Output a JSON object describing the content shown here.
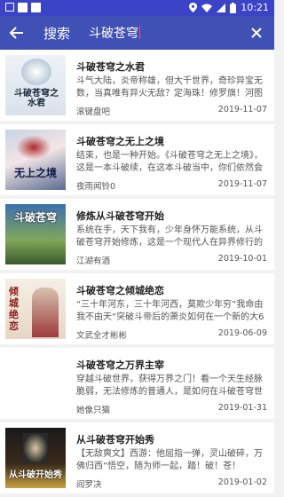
{
  "status_bar": {
    "time": "10:21"
  },
  "app_bar": {
    "title": "搜索",
    "query": "斗破苍穹"
  },
  "results": [
    {
      "title": "斗破苍穹之水君",
      "desc": "斗气大陆，炎帝称雄，但大千世界，奇珍异宝无数，当真唯有异火无敌？定海珠！修罗旗！河图洛",
      "author": "滚键盘吧",
      "date": "2019-11-07",
      "cover_text": "斗破苍穹之水君"
    },
    {
      "title": "斗破苍穹之无上之境",
      "desc": "结束，也是一种开始。《斗破苍穹之无上之境》，这是一本斗破续，在这本斗破当中，你们依然会见",
      "author": "夜雨闻铃0",
      "date": "2019-11-07",
      "cover_text": "无上之境"
    },
    {
      "title": "修炼从斗破苍穹开始",
      "desc": "系统在手，天下我有，少年身怀万能系统，从斗破苍穹开始修炼，这是一个现代人在异界修行的故",
      "author": "江湖有酒",
      "date": "2019-10-01",
      "cover_text": "斗破苍穹"
    },
    {
      "title": "斗破苍穹之倾城绝恋",
      "desc": "“三十年河东，三十年河西，莫欺少年穷”我命由我不由天“突破斗帝后的萧炎如何在一个新的大6上重",
      "author": "文武全才彬彬",
      "date": "2019-06-09",
      "cover_text": "倾城绝恋"
    },
    {
      "title": "斗破苍穹之万界主宰",
      "desc": "穿越斗破世界，获得万界之门！看一个天生经脉脆弱，无法修炼的普通人，是如何在斗破苍穹世界立",
      "author": "她像只猫",
      "date": "2019-01-31",
      "cover_text": ""
    },
    {
      "title": "从斗破苍穹开始秀",
      "desc": "【无敌爽文】西游：他屈指一弹，灵山破碎，万佛归西“悟空，随为师一起，踏！破！苍！穹！”斗破：",
      "author": "阎罗决",
      "date": "2019-01-02",
      "cover_text": "从斗破开始秀"
    }
  ]
}
